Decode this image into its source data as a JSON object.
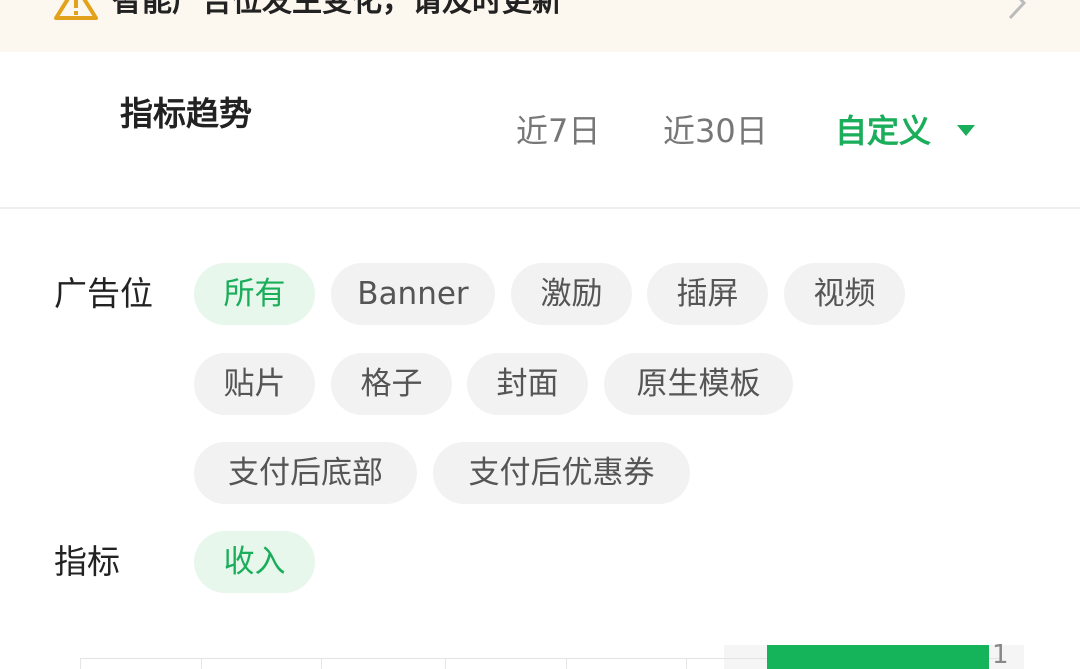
{
  "notice": {
    "text": "智能广告位发生变化，请及时更新",
    "icon": "warning-icon",
    "icon_color": "#e2a21c"
  },
  "header": {
    "title": "指标趋势",
    "ranges": [
      "近7日",
      "近30日",
      "自定义"
    ],
    "selected_range": "自定义"
  },
  "filters": {
    "ad_slot_label": "广告位",
    "ad_slots": [
      "所有",
      "Banner",
      "激励",
      "插屏",
      "视频",
      "贴片",
      "格子",
      "封面",
      "原生模板",
      "支付后底部",
      "支付后优惠券"
    ],
    "selected_ad_slot": "所有",
    "metric_label": "指标",
    "metrics": [
      "收入"
    ],
    "selected_metric": "收入"
  },
  "colors": {
    "accent": "#1aad5a",
    "chip_bg": "#f2f2f2",
    "chip_active_bg": "#e7f7ec",
    "notice_bg": "#fdf8ef"
  }
}
